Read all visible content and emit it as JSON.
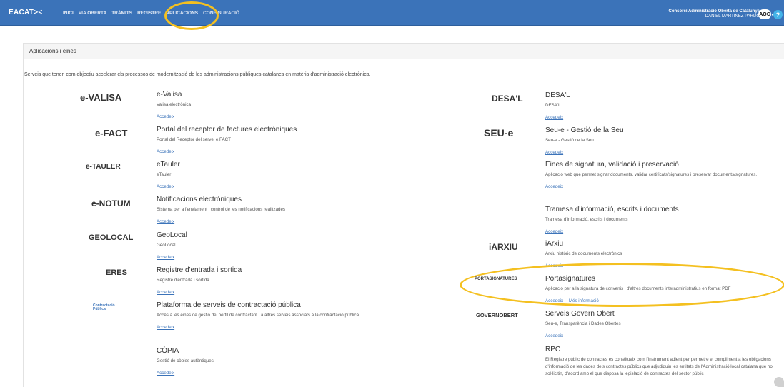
{
  "header": {
    "brand": "EACAT><",
    "nav": [
      "INICI",
      "VIA OBERTA",
      "TRÀMITS",
      "REGISTRE",
      "APLICACIONS",
      "CONFIGURACIÓ"
    ],
    "org": "Consorci Administració Oberta de Catalunya",
    "user": "DANIEL MARTINEZ PARDO",
    "avatar_text": "AOC",
    "help": "?"
  },
  "panel": {
    "title": "Aplicacions i eines",
    "intro": "Serveis que tenen com objectiu accelerar els processos de modernització de les administracions públiques catalanes en matèria d'administració electrònica."
  },
  "left_items": [
    {
      "logo": "e-VALISA",
      "title": "e-Valisa",
      "desc": "Valisa electrònica",
      "links": [
        "Accedeix"
      ]
    },
    {
      "logo": "e-FACT",
      "title": "Portal del receptor de factures electròniques",
      "desc": "Portal del Receptor del servei e.FACT",
      "links": [
        "Accedeix"
      ]
    },
    {
      "logo": "e-TAULER",
      "title": "eTauler",
      "desc": "eTauler",
      "links": [
        "Accedeix"
      ]
    },
    {
      "logo": "e-NOTUM",
      "title": "Notificacions electròniques",
      "desc": "Sistema per a l'enviament i control de les notificacions realitzades",
      "links": [
        "Accedeix"
      ]
    },
    {
      "logo": "GEOLOCAL",
      "title": "GeoLocal",
      "desc": "GeoLocal",
      "links": [
        "Accedeix"
      ]
    },
    {
      "logo": "ERES",
      "title": "Registre d'entrada i sortida",
      "desc": "Registre d'entrada i sortida",
      "links": [
        "Accedeix"
      ]
    },
    {
      "logo": "Contractació Pública",
      "title": "Plataforma de serveis de contractació pública",
      "desc": "Accés a les eines de gestió del perfil de contractant i a altres serveis associats a la contractació pública",
      "links": [
        "Accedeix"
      ]
    },
    {
      "logo": "",
      "title": "CÒPIA",
      "desc": "Gestió de còpies autèntiques",
      "links": [
        "Accedeix"
      ]
    }
  ],
  "right_items": [
    {
      "logo": "DESA'L",
      "title": "DESA'L",
      "desc": "DESA'L",
      "links": [
        "Accedeix"
      ]
    },
    {
      "logo": "SEU-e",
      "title": "Seu-e - Gestió de la Seu",
      "desc": "Seu-e - Gestió de la Seu",
      "links": [
        "Accedeix"
      ]
    },
    {
      "logo": "",
      "title": "Eines de signatura, validació i preservació",
      "desc": "Aplicació web que permet signar documents, validar certificats/signatures i preservar documents/signatures.",
      "links": [
        "Accedeix"
      ]
    },
    {
      "logo": "",
      "title": "Tramesa d'informació, escrits i documents",
      "desc": "Tramesa d'informació, escrits i documents",
      "links": [
        "Accedeix"
      ]
    },
    {
      "logo": "iARXIU",
      "title": "iArxiu",
      "desc": "Arxiu històric de documents electrònics",
      "links": [
        "Accedeix"
      ]
    },
    {
      "logo": "PORTASIGNATURES",
      "title": "Portasignatures",
      "desc": "Aplicació per a la signatura de convenis i d'altres documents interadministratius en format PDF",
      "links": [
        "Accedeix",
        "Més informació"
      ]
    },
    {
      "logo": "GOVERNOBERT",
      "title": "Serveis Govern Obert",
      "desc": "Seu-e, Transparència i Dades Obertes",
      "links": [
        "Accedeix"
      ]
    },
    {
      "logo": "",
      "title": "RPC",
      "desc": "El Registre públic de contractes es constitueix com l'instrument adient per permetre el compliment a les obligacions d'informació de les dades dels contractes públics que adjudiquin les entitats de l'Administració local catalana que ho sol·licitin, d'acord amb el que disposa la legislació de contractes del sector públic",
      "links": []
    }
  ]
}
